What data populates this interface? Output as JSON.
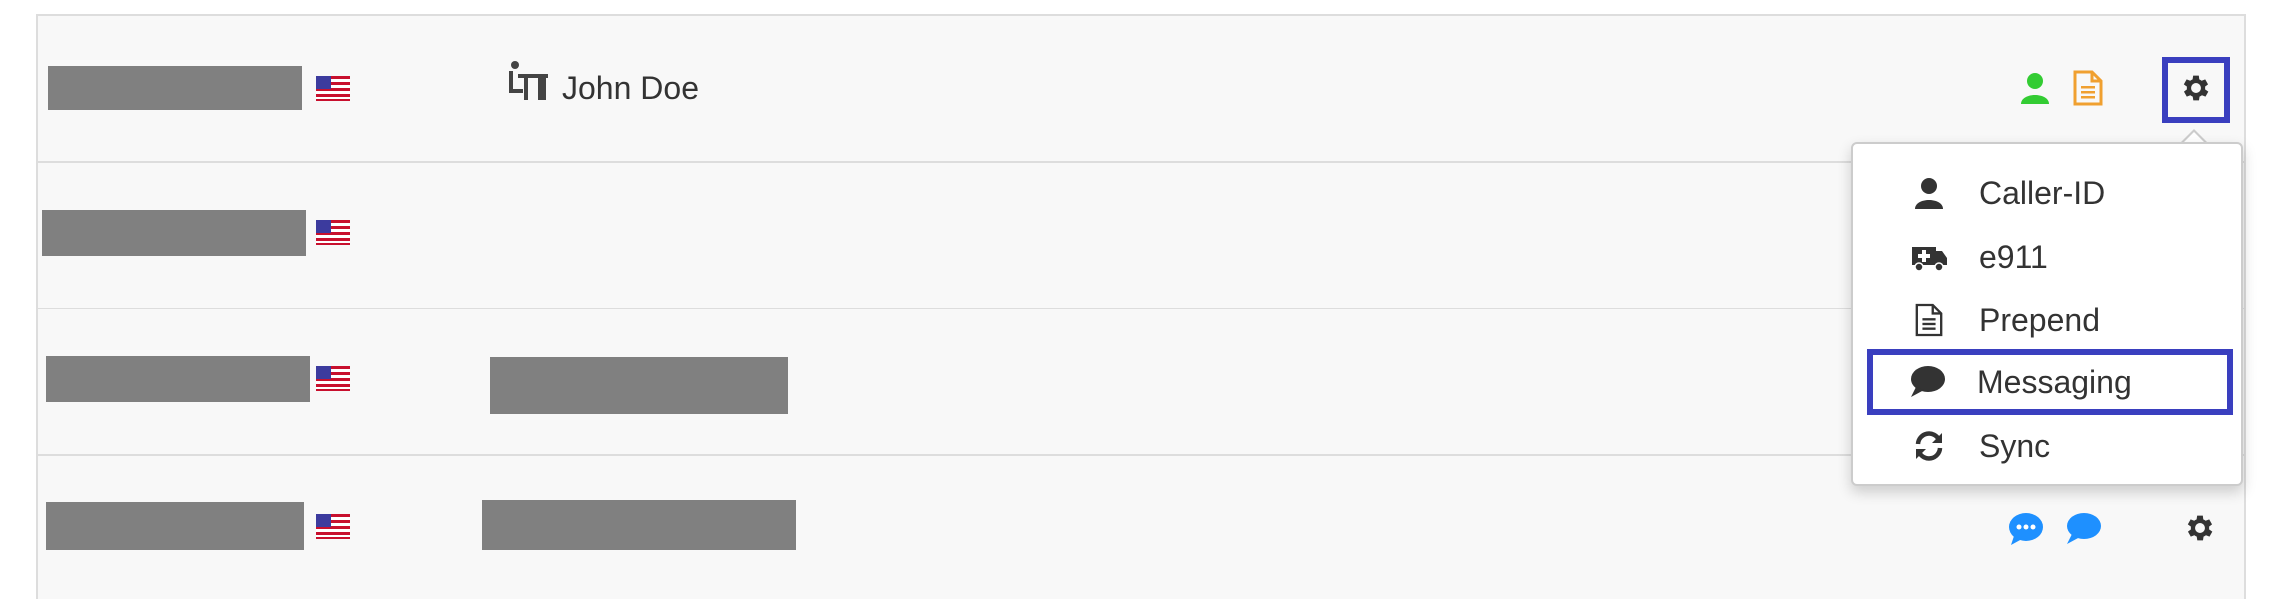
{
  "rows": [
    {
      "name": "John Doe",
      "flag": "us-flag-icon"
    },
    {
      "name": "",
      "flag": "us-flag-icon"
    },
    {
      "name": "",
      "flag": "us-flag-icon"
    },
    {
      "name": "",
      "flag": "us-flag-icon"
    }
  ],
  "icons": {
    "agent": "desk-agent-icon",
    "user": "user-icon",
    "document": "document-icon",
    "settings": "gear-icon",
    "sms": "sms-bubble-icon",
    "chat": "chat-bubble-icon"
  },
  "colors": {
    "highlight": "#3a3fbf",
    "user_icon": "#33cc33",
    "document_icon": "#f0a030",
    "message_icon": "#1e90ff",
    "redaction": "#808080"
  },
  "dropdown": {
    "items": [
      {
        "label": "Caller-ID",
        "icon": "user-icon"
      },
      {
        "label": "e911",
        "icon": "ambulance-icon"
      },
      {
        "label": "Prepend",
        "icon": "document-icon"
      },
      {
        "label": "Messaging",
        "icon": "chat-bubble-icon"
      },
      {
        "label": "Sync",
        "icon": "sync-icon"
      }
    ]
  }
}
